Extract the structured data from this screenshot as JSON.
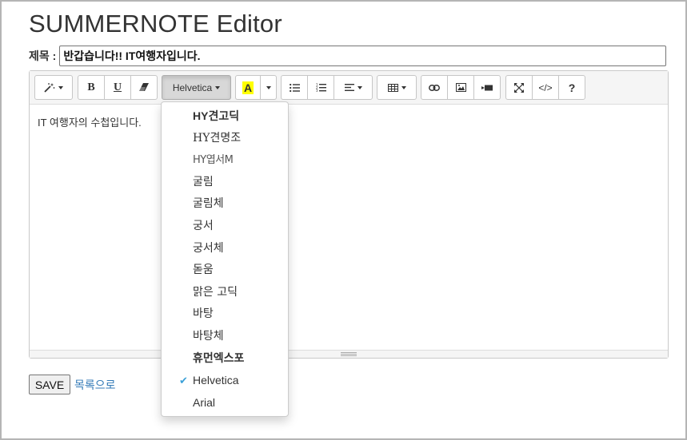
{
  "page": {
    "title": "SUMMERNOTE Editor"
  },
  "subject": {
    "label": "제목 :",
    "value": "반갑습니다!! IT여행자입니다."
  },
  "toolbar": {
    "style_icon": "magic-wand-icon",
    "bold_label": "B",
    "underline_label": "U",
    "eraser_icon": "eraser-icon",
    "font_name": "Helvetica",
    "color_label": "A",
    "color_highlight": "#ffff00",
    "unordered_list_icon": "unordered-list-icon",
    "ordered_list_icon": "ordered-list-icon",
    "paragraph_icon": "align-left-icon",
    "table_icon": "table-icon",
    "link_icon": "link-icon",
    "picture_icon": "picture-icon",
    "video_icon": "video-icon",
    "fullscreen_icon": "expand-icon",
    "codeview_label": "</>",
    "help_label": "?"
  },
  "content": {
    "text": "IT 여행자의 수첩입니다."
  },
  "font_dropdown": {
    "selected": "Helvetica",
    "items": [
      "HY견고딕",
      "HY견명조",
      "HY엽서M",
      "굴림",
      "굴림체",
      "궁서",
      "궁서체",
      "돋움",
      "맑은 고딕",
      "바탕",
      "바탕체",
      "휴먼엑스포",
      "Helvetica",
      "Arial"
    ],
    "check_mark": "✔"
  },
  "actions": {
    "save_label": "SAVE",
    "list_link": "목록으로"
  },
  "colors": {
    "link": "#337ab7",
    "check": "#3aa0d8",
    "toolbar_bg": "#f5f5f5"
  }
}
